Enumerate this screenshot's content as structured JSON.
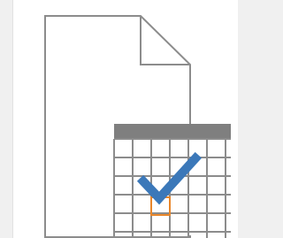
{
  "template_tile": {
    "icon": "blank-document-calendar-template-icon",
    "colors": {
      "page_background": "#f0f0f0",
      "tile_background": "#ffffff",
      "document_outline": "#8c8c8c",
      "calendar_header": "#7f7f7f",
      "calendar_grid": "#8c8c8c",
      "checkmark": "#3b78b9",
      "highlight_cell": "#e8862a"
    }
  }
}
